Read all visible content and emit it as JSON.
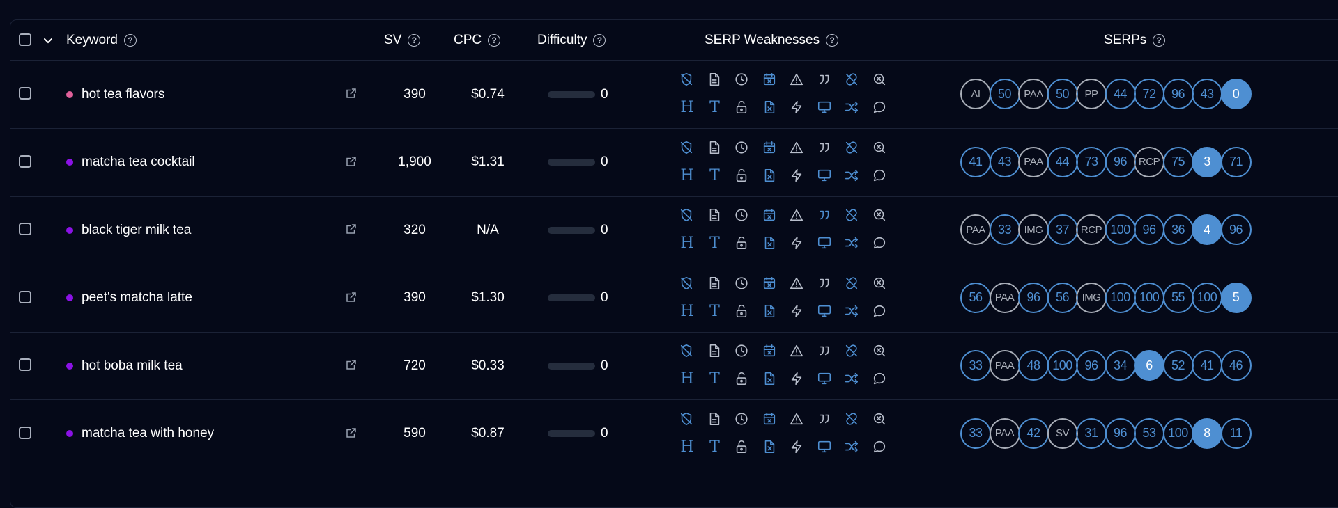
{
  "header": {
    "keyword": "Keyword",
    "sv": "SV",
    "cpc": "CPC",
    "difficulty": "Difficulty",
    "serp_weaknesses": "SERP Weaknesses",
    "serps": "SERPs",
    "help_glyph": "?"
  },
  "weakness_icons": [
    "shield-off-icon",
    "file-icon",
    "clock-icon",
    "calendar-x-icon",
    "alert-triangle-icon",
    "quote-icon",
    "link-broken-icon",
    "search-x-icon",
    "heading-h-icon",
    "text-t-icon",
    "unlock-icon",
    "file-x-icon",
    "zap-icon",
    "monitor-icon",
    "shuffle-icon",
    "chat-bubble-icon"
  ],
  "colors": {
    "accent": "#4e8fd2",
    "pink_dot": "#e0609a",
    "purple_dot": "#8b12e6",
    "gray": "#a9aeb8"
  },
  "rows": [
    {
      "keyword": "hot tea flavors",
      "dot": "pink",
      "sv": "390",
      "cpc": "$0.74",
      "difficulty": "0",
      "highlight_quote": false,
      "serps": [
        {
          "label": "AI",
          "kind": "gray"
        },
        {
          "label": "50",
          "kind": "outline"
        },
        {
          "label": "PAA",
          "kind": "gray"
        },
        {
          "label": "50",
          "kind": "outline"
        },
        {
          "label": "PP",
          "kind": "gray"
        },
        {
          "label": "44",
          "kind": "outline"
        },
        {
          "label": "72",
          "kind": "outline"
        },
        {
          "label": "96",
          "kind": "outline"
        },
        {
          "label": "43",
          "kind": "outline"
        },
        {
          "label": "0",
          "kind": "filled"
        }
      ]
    },
    {
      "keyword": "matcha tea cocktail",
      "dot": "purple",
      "sv": "1,900",
      "cpc": "$1.31",
      "difficulty": "0",
      "highlight_quote": false,
      "serps": [
        {
          "label": "41",
          "kind": "outline"
        },
        {
          "label": "43",
          "kind": "outline"
        },
        {
          "label": "PAA",
          "kind": "gray"
        },
        {
          "label": "44",
          "kind": "outline"
        },
        {
          "label": "73",
          "kind": "outline"
        },
        {
          "label": "96",
          "kind": "outline"
        },
        {
          "label": "RCP",
          "kind": "gray"
        },
        {
          "label": "75",
          "kind": "outline"
        },
        {
          "label": "3",
          "kind": "filled"
        },
        {
          "label": "71",
          "kind": "outline"
        }
      ]
    },
    {
      "keyword": "black tiger milk tea",
      "dot": "purple",
      "sv": "320",
      "cpc": "N/A",
      "difficulty": "0",
      "highlight_quote": true,
      "serps": [
        {
          "label": "PAA",
          "kind": "gray"
        },
        {
          "label": "33",
          "kind": "outline"
        },
        {
          "label": "IMG",
          "kind": "gray"
        },
        {
          "label": "37",
          "kind": "outline"
        },
        {
          "label": "RCP",
          "kind": "gray"
        },
        {
          "label": "100",
          "kind": "outline"
        },
        {
          "label": "96",
          "kind": "outline"
        },
        {
          "label": "36",
          "kind": "outline"
        },
        {
          "label": "4",
          "kind": "filled"
        },
        {
          "label": "96",
          "kind": "outline"
        }
      ]
    },
    {
      "keyword": "peet's matcha latte",
      "dot": "purple",
      "sv": "390",
      "cpc": "$1.30",
      "difficulty": "0",
      "highlight_quote": false,
      "serps": [
        {
          "label": "56",
          "kind": "outline"
        },
        {
          "label": "PAA",
          "kind": "gray"
        },
        {
          "label": "96",
          "kind": "outline"
        },
        {
          "label": "56",
          "kind": "outline"
        },
        {
          "label": "IMG",
          "kind": "gray"
        },
        {
          "label": "100",
          "kind": "outline"
        },
        {
          "label": "100",
          "kind": "outline"
        },
        {
          "label": "55",
          "kind": "outline"
        },
        {
          "label": "100",
          "kind": "outline"
        },
        {
          "label": "5",
          "kind": "filled"
        }
      ]
    },
    {
      "keyword": "hot boba milk tea",
      "dot": "purple",
      "sv": "720",
      "cpc": "$0.33",
      "difficulty": "0",
      "highlight_quote": false,
      "serps": [
        {
          "label": "33",
          "kind": "outline"
        },
        {
          "label": "PAA",
          "kind": "gray"
        },
        {
          "label": "48",
          "kind": "outline"
        },
        {
          "label": "100",
          "kind": "outline"
        },
        {
          "label": "96",
          "kind": "outline"
        },
        {
          "label": "34",
          "kind": "outline"
        },
        {
          "label": "6",
          "kind": "filled"
        },
        {
          "label": "52",
          "kind": "outline"
        },
        {
          "label": "41",
          "kind": "outline"
        },
        {
          "label": "46",
          "kind": "outline"
        }
      ]
    },
    {
      "keyword": "matcha tea with honey",
      "dot": "purple",
      "sv": "590",
      "cpc": "$0.87",
      "difficulty": "0",
      "highlight_quote": false,
      "serps": [
        {
          "label": "33",
          "kind": "outline"
        },
        {
          "label": "PAA",
          "kind": "gray"
        },
        {
          "label": "42",
          "kind": "outline"
        },
        {
          "label": "SV",
          "kind": "gray"
        },
        {
          "label": "31",
          "kind": "outline"
        },
        {
          "label": "96",
          "kind": "outline"
        },
        {
          "label": "53",
          "kind": "outline"
        },
        {
          "label": "100",
          "kind": "outline"
        },
        {
          "label": "8",
          "kind": "filled"
        },
        {
          "label": "11",
          "kind": "outline"
        }
      ]
    }
  ]
}
